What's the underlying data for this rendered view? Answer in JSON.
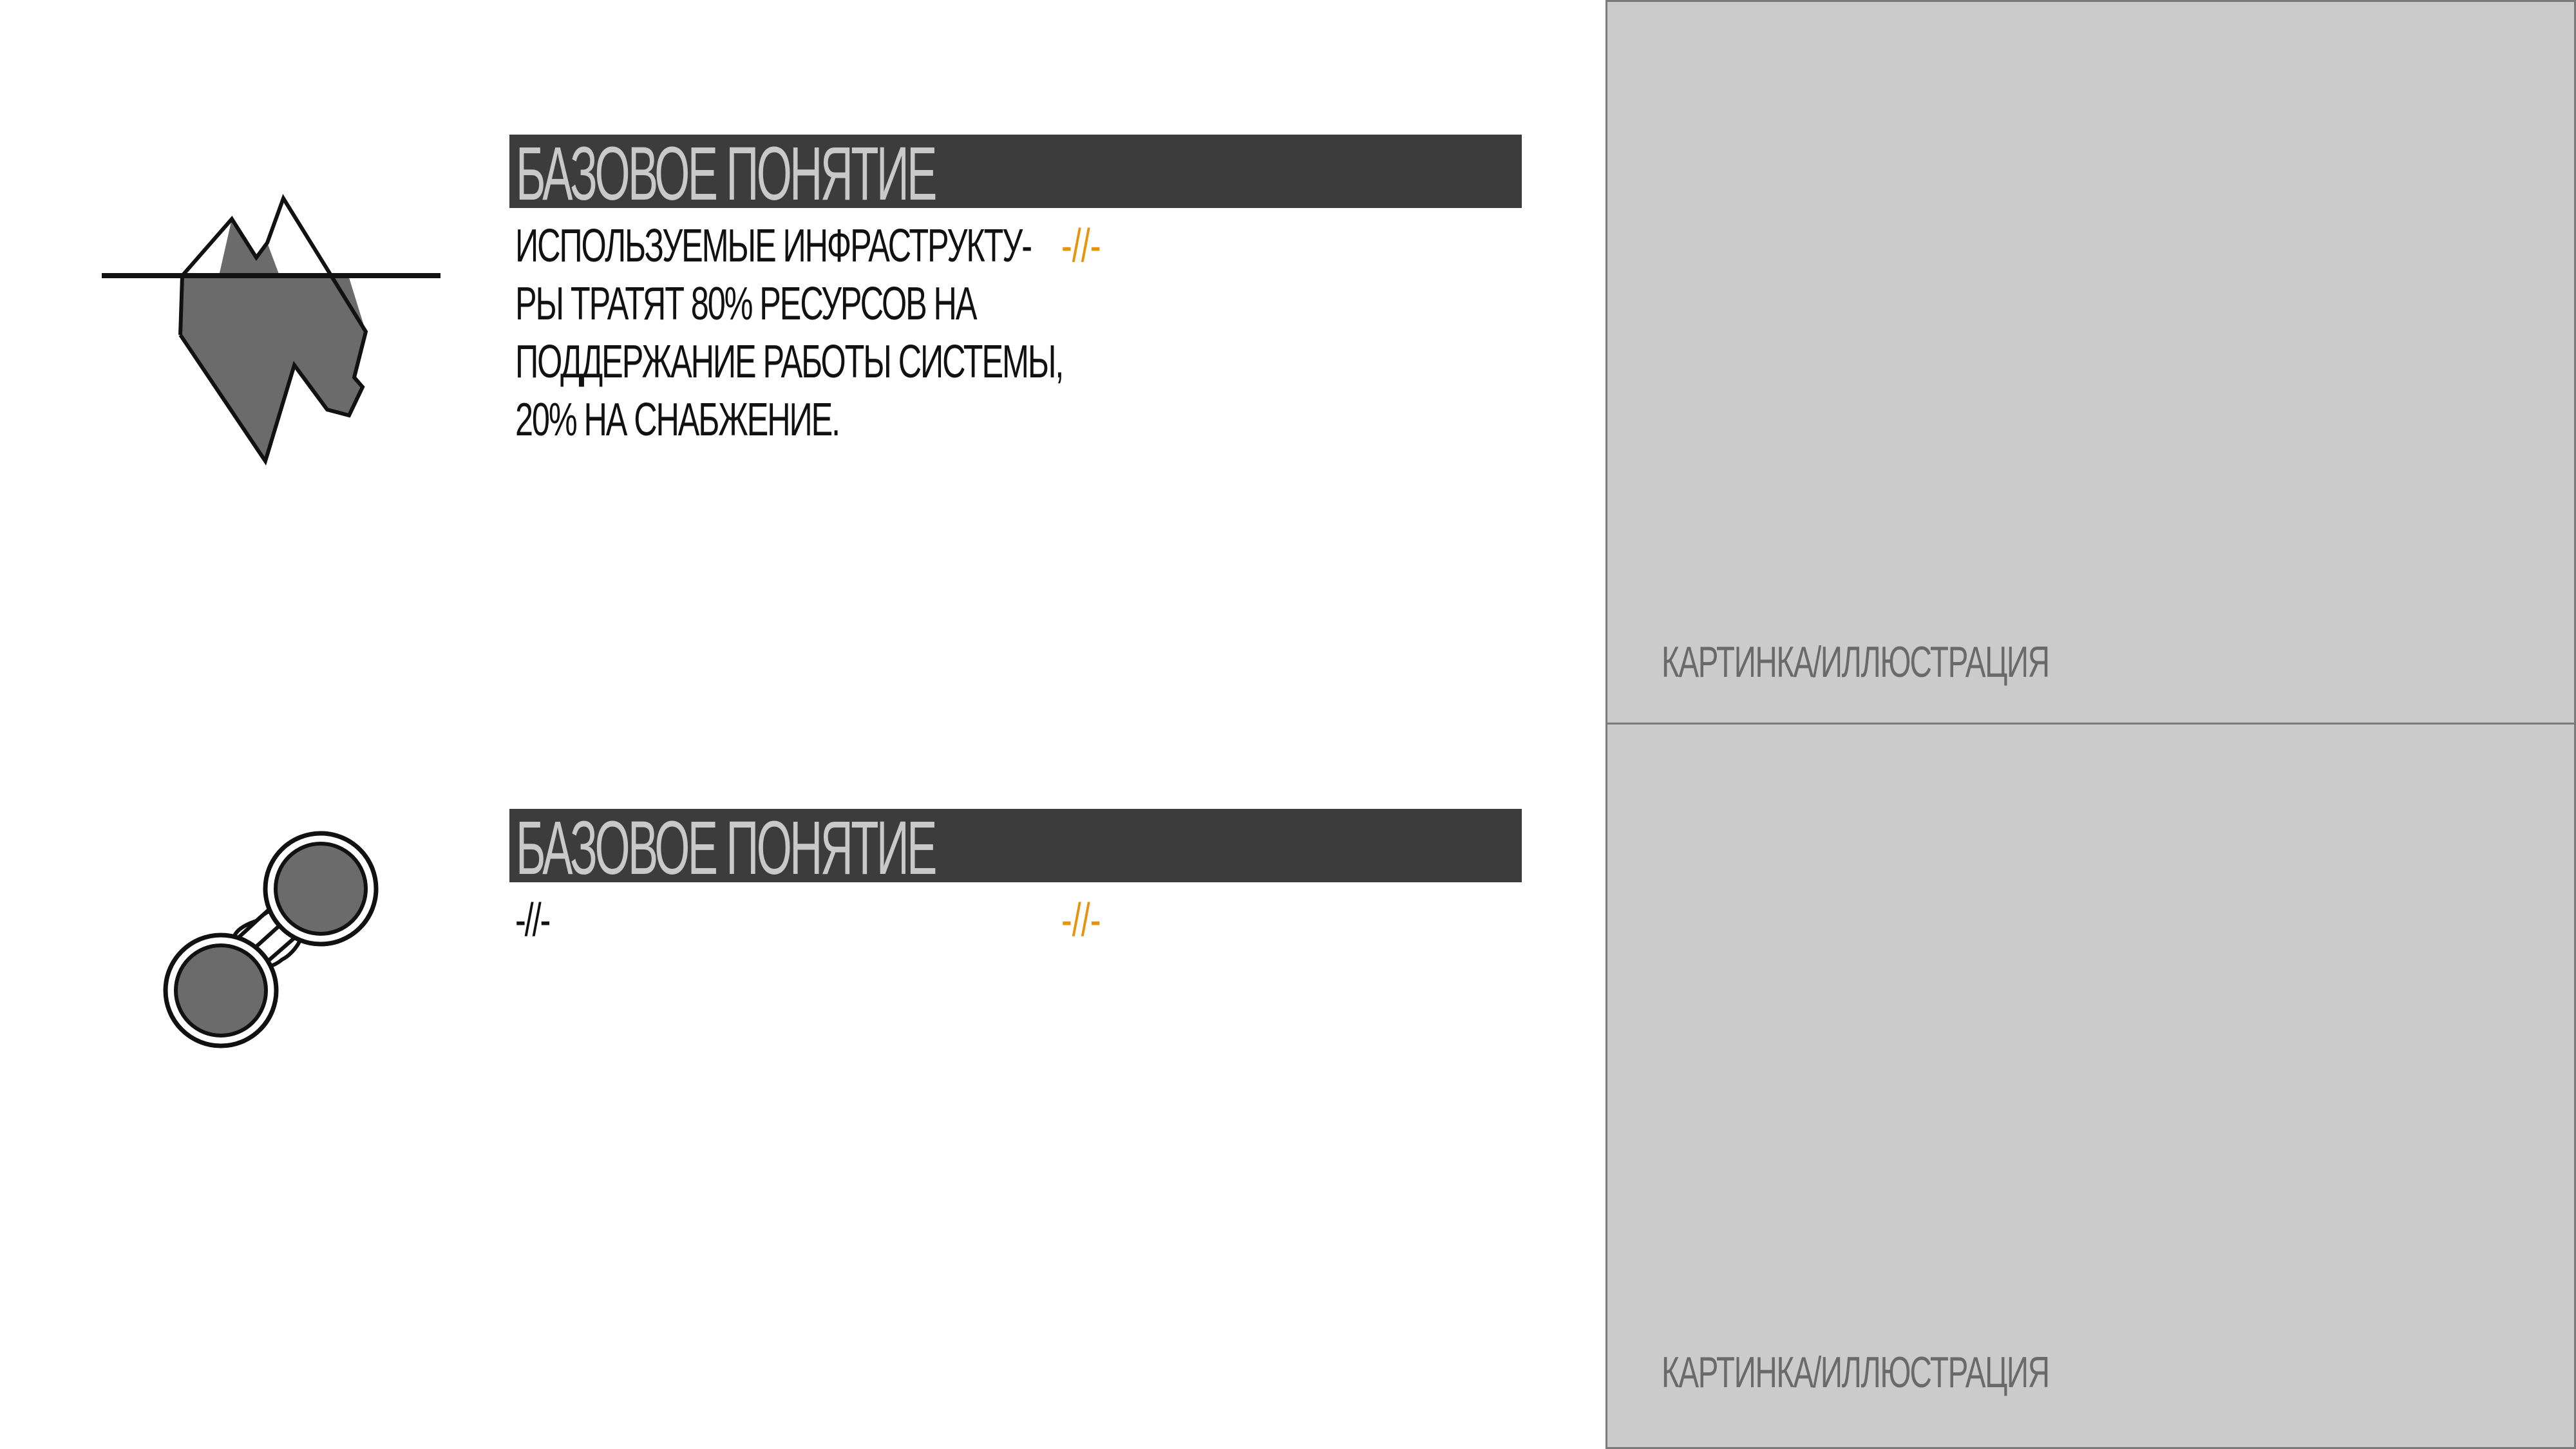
{
  "concepts": [
    {
      "icon": "iceberg-icon",
      "heading": "БАЗОВОЕ ПОНЯТИЕ",
      "body_lines": [
        "ИСПОЛЬЗУЕМЫЕ ИНФРАСТРУКТУ-",
        "РЫ ТРАТЯТ 80% РЕСУРСОВ НА",
        "ПОДДЕРЖАНИЕ РАБОТЫ СИСТЕМЫ,",
        "20% НА СНАБЖЕНИЕ."
      ],
      "note": "-//-"
    },
    {
      "icon": "linked-circles-icon",
      "heading": "БАЗОВОЕ ПОНЯТИЕ",
      "body_lines": [
        "-//-"
      ],
      "note": "-//-"
    }
  ],
  "panels": [
    {
      "label": "КАРТИНКА/ИЛЛЮСТРАЦИЯ"
    },
    {
      "label": "КАРТИНКА/ИЛЛЮСТРАЦИЯ"
    }
  ],
  "colors": {
    "heading_bar": "#3c3c3c",
    "heading_text": "#c9c9c9",
    "accent": "#e8940a",
    "panel_fill": "#cbcbcb",
    "icon_fill": "#6b6b6b"
  }
}
